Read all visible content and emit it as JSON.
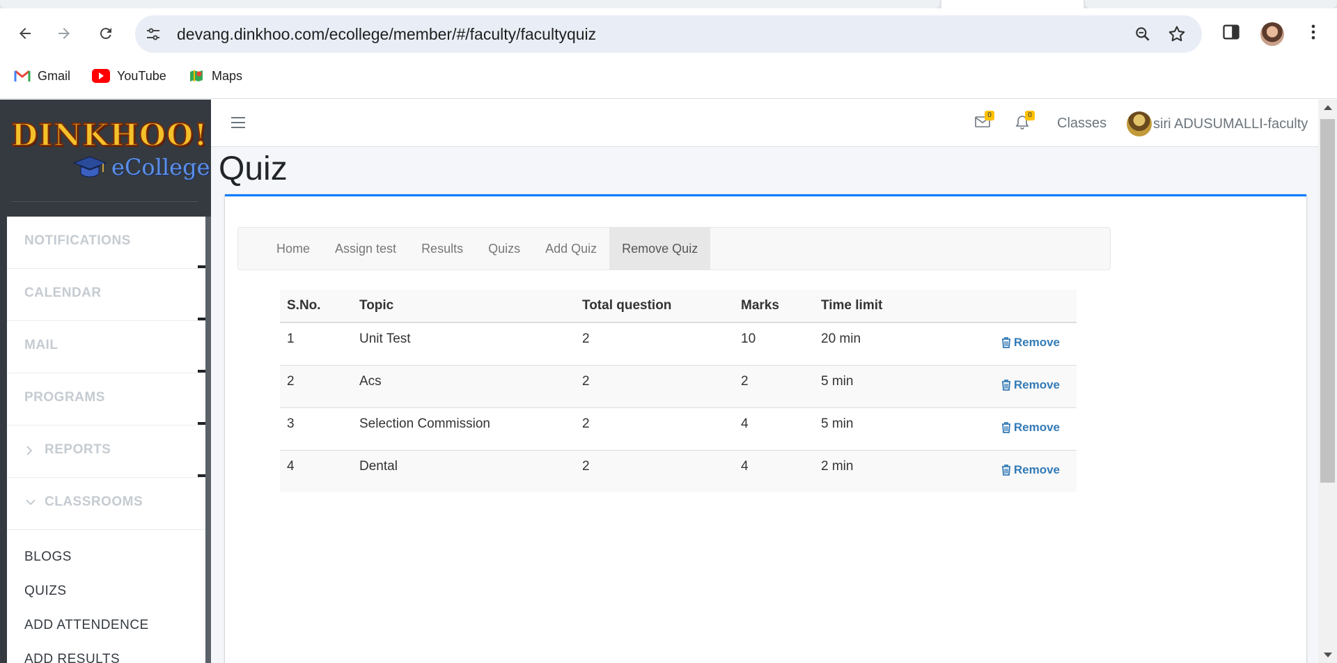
{
  "browser": {
    "url": "devang.dinkhoo.com/ecollege/member/#/faculty/facultyquiz",
    "bookmarks": [
      {
        "label": "Gmail",
        "icon": "gmail-icon"
      },
      {
        "label": "YouTube",
        "icon": "youtube-icon"
      },
      {
        "label": "Maps",
        "icon": "maps-icon"
      }
    ]
  },
  "brand": {
    "logo_text": "DINKHOO!",
    "logo_sub": "eCollege"
  },
  "sidebar": {
    "sections": [
      {
        "label": "NOTIFICATIONS"
      },
      {
        "label": "CALENDAR"
      },
      {
        "label": "MAIL"
      },
      {
        "label": "PROGRAMS"
      },
      {
        "label": "REPORTS",
        "chevron": "chevron-right"
      },
      {
        "label": "CLASSROOMS",
        "chevron": "chevron-down"
      }
    ],
    "items": [
      {
        "label": "BLOGS"
      },
      {
        "label": "QUIZS"
      },
      {
        "label": "ADD ATTENDENCE"
      },
      {
        "label": "ADD RESULTS"
      }
    ]
  },
  "topnav": {
    "mail_badge": "0",
    "notification_badge": "0",
    "classes_label": "Classes",
    "user_name": "siri ADUSUMALLI-faculty"
  },
  "page": {
    "title": "Quiz"
  },
  "subnav": {
    "tabs": [
      {
        "label": "Home"
      },
      {
        "label": "Assign test"
      },
      {
        "label": "Results"
      },
      {
        "label": "Quizs"
      },
      {
        "label": "Add Quiz"
      },
      {
        "label": "Remove Quiz",
        "active": true
      }
    ]
  },
  "table": {
    "headers": [
      "S.No.",
      "Topic",
      "Total question",
      "Marks",
      "Time limit",
      ""
    ],
    "action_label": "Remove",
    "rows": [
      {
        "sno": "1",
        "topic": "Unit Test",
        "total": "2",
        "marks": "10",
        "time": "20 min"
      },
      {
        "sno": "2",
        "topic": "Acs",
        "total": "2",
        "marks": "2",
        "time": "5 min"
      },
      {
        "sno": "3",
        "topic": "Selection Commission",
        "total": "2",
        "marks": "4",
        "time": "5 min"
      },
      {
        "sno": "4",
        "topic": "Dental",
        "total": "2",
        "marks": "4",
        "time": "2 min"
      }
    ]
  },
  "colors": {
    "accent": "#007bff",
    "sidebar_bg": "#343a40",
    "link": "#337ab7",
    "badge": "#ffc107"
  }
}
